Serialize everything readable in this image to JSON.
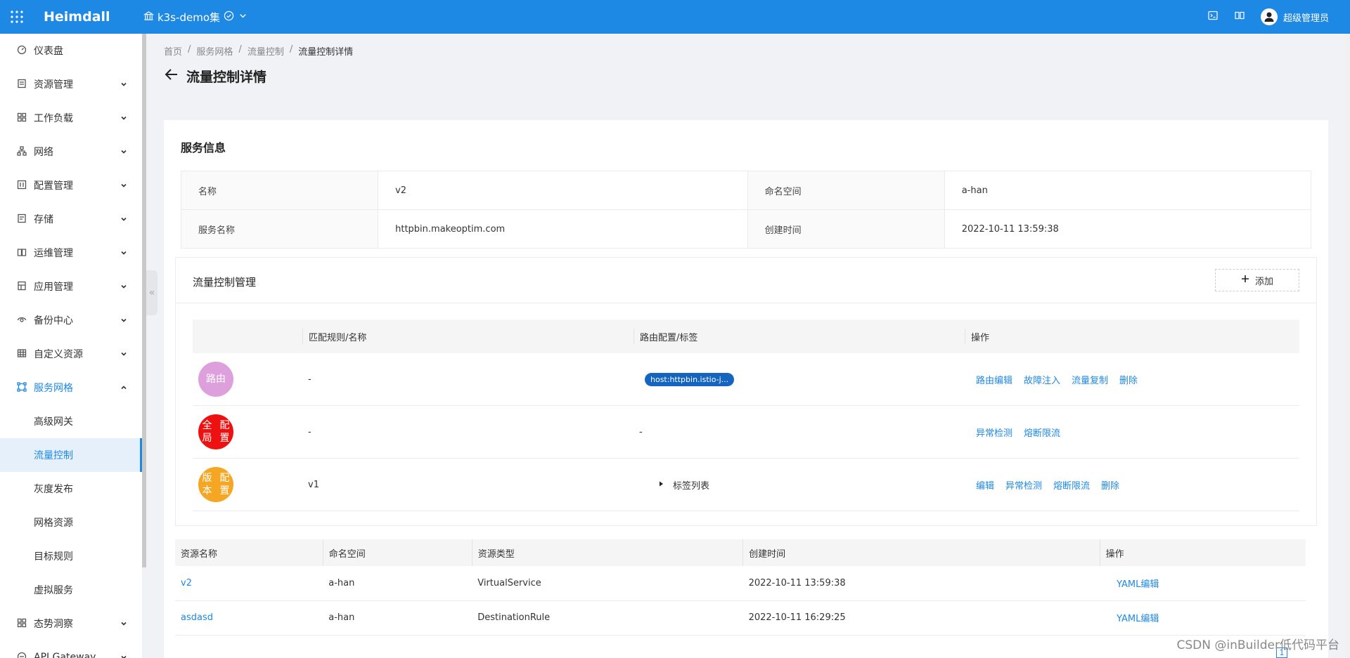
{
  "app": {
    "title": "Heimdall",
    "cluster": "k3s-demo集"
  },
  "header": {
    "user": "超级管理员",
    "icons": [
      "terminal-icon",
      "book-icon"
    ]
  },
  "sidebar": {
    "items": [
      {
        "label": "仪表盘",
        "icon": "dashboard-icon",
        "expandable": false
      },
      {
        "label": "资源管理",
        "icon": "resource-icon",
        "expandable": true
      },
      {
        "label": "工作负载",
        "icon": "workload-icon",
        "expandable": true
      },
      {
        "label": "网络",
        "icon": "network-icon",
        "expandable": true
      },
      {
        "label": "配置管理",
        "icon": "config-icon",
        "expandable": true
      },
      {
        "label": "存储",
        "icon": "storage-icon",
        "expandable": true
      },
      {
        "label": "运维管理",
        "icon": "ops-icon",
        "expandable": true
      },
      {
        "label": "应用管理",
        "icon": "app-icon",
        "expandable": true
      },
      {
        "label": "备份中心",
        "icon": "backup-icon",
        "expandable": true
      },
      {
        "label": "自定义资源",
        "icon": "custom-resource-icon",
        "expandable": true
      },
      {
        "label": "服务网格",
        "icon": "mesh-icon",
        "expandable": true,
        "open": true
      },
      {
        "label": "态势洞察",
        "icon": "insight-icon",
        "expandable": true
      },
      {
        "label": "API Gateway",
        "icon": "gateway-icon",
        "expandable": true
      }
    ],
    "mesh_subitems": [
      "高级网关",
      "流量控制",
      "灰度发布",
      "网格资源",
      "目标规则",
      "虚拟服务"
    ],
    "active_subitem": "流量控制"
  },
  "breadcrumb": [
    "首页",
    "服务网格",
    "流量控制",
    "流量控制详情"
  ],
  "page": {
    "title": "流量控制详情"
  },
  "service_info": {
    "title": "服务信息",
    "name_label": "名称",
    "name": "v2",
    "namespace_label": "命名空间",
    "namespace": "a-han",
    "service_label": "服务名称",
    "service": "httpbin.makeoptim.com",
    "created_label": "创建时间",
    "created": "2022-10-11 13:59:38"
  },
  "flow": {
    "title": "流量控制管理",
    "add_label": "添加",
    "columns": [
      "",
      "匹配规则/名称",
      "路由配置/标签",
      "操作"
    ],
    "rows": [
      {
        "badge": "路由",
        "color": "#dda0dd",
        "match": "-",
        "route_tag": "host:httpbin.istio-j...",
        "actions": [
          "路由编辑",
          "故障注入",
          "流量复制",
          "删除"
        ]
      },
      {
        "badge_line1": "全局",
        "badge_line2": "配置",
        "color": "#ee1111",
        "match": "-",
        "route": "-",
        "actions": [
          "异常检测",
          "熔断限流"
        ]
      },
      {
        "badge_line1": "版本",
        "badge_line2": "配置",
        "color": "#f5a623",
        "match": "v1",
        "tag_list": "标签列表",
        "actions": [
          "编辑",
          "异常检测",
          "熔断限流",
          "删除"
        ]
      }
    ]
  },
  "resources": {
    "columns": [
      "资源名称",
      "命名空间",
      "资源类型",
      "创建时间",
      "操作"
    ],
    "rows": [
      {
        "name": "v2",
        "namespace": "a-han",
        "type": "VirtualService",
        "created": "2022-10-11 13:59:38",
        "action": "YAML编辑"
      },
      {
        "name": "asdasd",
        "namespace": "a-han",
        "type": "DestinationRule",
        "created": "2022-10-11 16:29:25",
        "action": "YAML编辑"
      }
    ]
  },
  "pager": {
    "current": "1"
  },
  "watermark": "CSDN @inBuilder低代码平台"
}
